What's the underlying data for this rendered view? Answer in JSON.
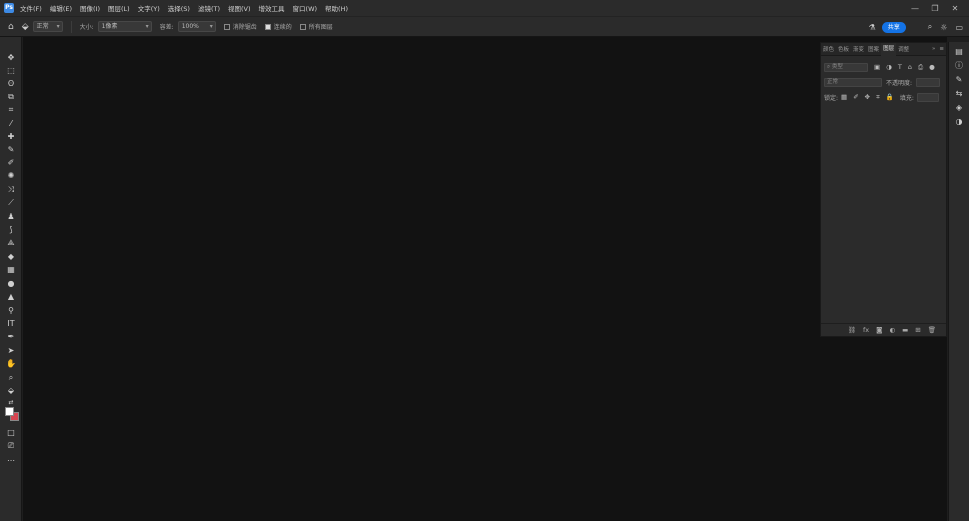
{
  "menu": {
    "items": [
      "文件(F)",
      "编辑(E)",
      "图像(I)",
      "图层(L)",
      "文字(Y)",
      "选择(S)",
      "滤镜(T)",
      "视图(V)",
      "增效工具",
      "窗口(W)",
      "帮助(H)"
    ]
  },
  "window": {
    "minimize": "—",
    "restore": "❐",
    "close": "✕"
  },
  "options": {
    "mode_select": "正常",
    "size_label": "大小:",
    "size_value": "1像素",
    "tolerance_label": "容差:",
    "tolerance_value": "100%",
    "antialias_label": "消除锯齿",
    "contiguous_label": "连续的",
    "all_layers_label": "所有图层",
    "share_label": "共享"
  },
  "panel": {
    "tabs": [
      "颜色",
      "色板",
      "渐变",
      "图案",
      "图层",
      "调整"
    ],
    "active_tab": "图层",
    "kind_filter": "类型",
    "blend_mode": "正常",
    "opacity_label": "不透明度:",
    "lock_label": "锁定:",
    "fill_label": "填充:"
  },
  "colors": {
    "foreground": "#ffffff",
    "background": "#d64550",
    "accent": "#1473e6"
  }
}
